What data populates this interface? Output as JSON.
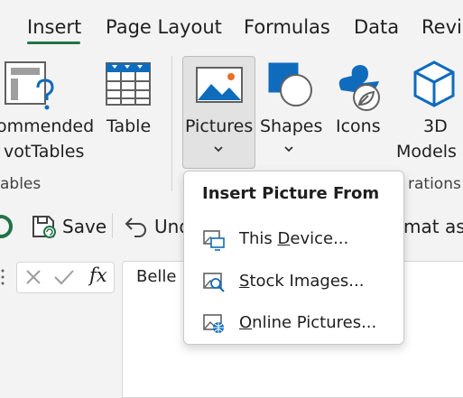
{
  "tabs": [
    {
      "label": "Insert",
      "active": true
    },
    {
      "label": "Page Layout"
    },
    {
      "label": "Formulas"
    },
    {
      "label": "Data"
    },
    {
      "label": "Revie"
    }
  ],
  "ribbon": {
    "recommended_line1": "ommended",
    "recommended_line2": "votTables",
    "table": "Table",
    "pictures": "Pictures",
    "shapes": "Shapes",
    "icons": "Icons",
    "models_line1": "3D",
    "models_line2": "Models",
    "group_tables": "ables",
    "group_illustrations": "rations"
  },
  "qat": {
    "save": "Save",
    "undo": "Und",
    "format_as": "mat as T"
  },
  "formula_bar": {
    "fx": "fx",
    "cell_text": "Belle"
  },
  "menu": {
    "title": "Insert Picture From",
    "items": [
      {
        "pre": "This ",
        "accel": "D",
        "post": "evice..."
      },
      {
        "pre": "",
        "accel": "S",
        "post": "tock Images..."
      },
      {
        "pre": "",
        "accel": "O",
        "post": "nline Pictures..."
      }
    ]
  },
  "colors": {
    "accent_green": "#217346",
    "icon_blue": "#0f6cbd"
  }
}
